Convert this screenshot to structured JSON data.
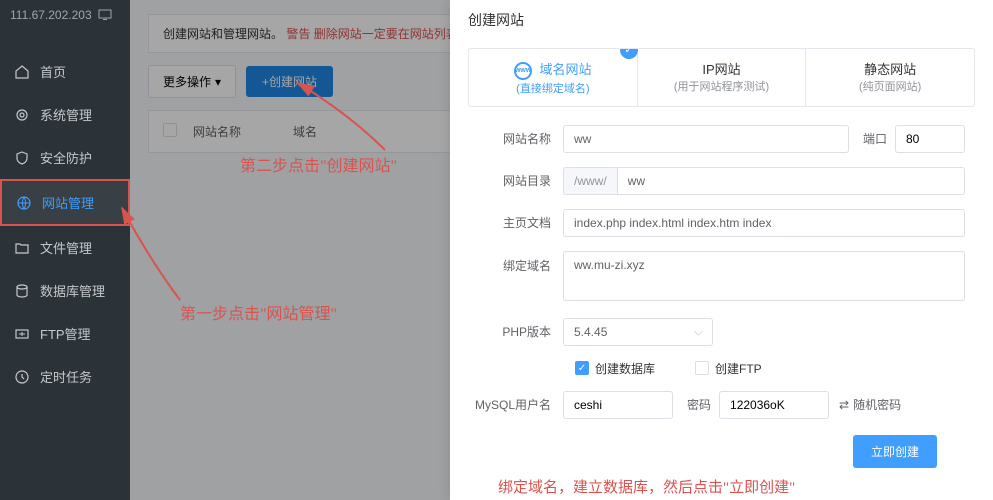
{
  "server_ip": "111.67.202.203",
  "sidebar": {
    "items": [
      {
        "label": "首页",
        "icon": "home"
      },
      {
        "label": "系统管理",
        "icon": "gear"
      },
      {
        "label": "安全防护",
        "icon": "shield"
      },
      {
        "label": "网站管理",
        "icon": "globe"
      },
      {
        "label": "文件管理",
        "icon": "folder"
      },
      {
        "label": "数据库管理",
        "icon": "database"
      },
      {
        "label": "FTP管理",
        "icon": "ftp"
      },
      {
        "label": "定时任务",
        "icon": "clock"
      }
    ]
  },
  "notice": {
    "text1": "创建网站和管理网站。",
    "warn": "警告 删除网站一定要在网站列表..."
  },
  "toolbar": {
    "more_label": "更多操作",
    "create_label": "+创建网站"
  },
  "table": {
    "col_name": "网站名称",
    "col_domain": "域名"
  },
  "annotations": {
    "step1": "第一步点击\"网站管理\"",
    "step2": "第二步点击\"创建网站\"",
    "step3": "绑定域名，建立数据库，然后点击\"立即创建\""
  },
  "modal": {
    "title": "创建网站",
    "tabs": [
      {
        "title": "域名网站",
        "sub": "(直接绑定域名)"
      },
      {
        "title": "IP网站",
        "sub": "(用于网站程序测试)"
      },
      {
        "title": "静态网站",
        "sub": "(纯页面网站)"
      }
    ],
    "labels": {
      "name": "网站名称",
      "port": "端口",
      "dir": "网站目录",
      "doc": "主页文档",
      "domain": "绑定域名",
      "php": "PHP版本",
      "create_db": "创建数据库",
      "create_ftp": "创建FTP",
      "mysql_user": "MySQL用户名",
      "pwd": "密码",
      "random": "随机密码",
      "submit": "立即创建"
    },
    "values": {
      "name": "ww",
      "port": "80",
      "dir_prefix": "/www/",
      "dir": "ww",
      "doc": "index.php index.html index.htm index",
      "domain": "ww.mu-zi.xyz",
      "php": "5.4.45",
      "mysql_user": "ceshi",
      "pwd": "122036oK"
    }
  }
}
